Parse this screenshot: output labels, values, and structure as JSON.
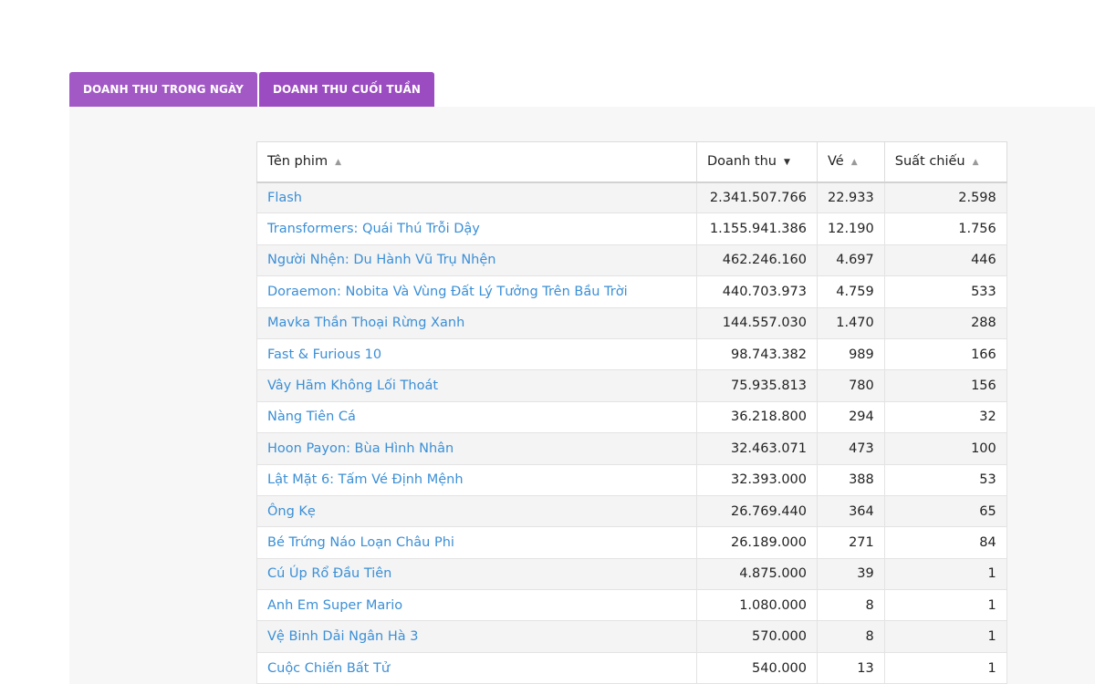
{
  "tabs": [
    {
      "label": "DOANH THU TRONG NGÀY",
      "active": false
    },
    {
      "label": "DOANH THU CUỐI TUẦN",
      "active": true
    }
  ],
  "table": {
    "columns": [
      {
        "label": "Tên phim",
        "sort": "up",
        "icon": "sort-up-icon"
      },
      {
        "label": "Doanh thu",
        "sort": "down",
        "icon": "sort-down-icon"
      },
      {
        "label": "Vé",
        "sort": "up",
        "icon": "sort-up-icon"
      },
      {
        "label": "Suất chiếu",
        "sort": "up",
        "icon": "sort-up-icon"
      }
    ],
    "rows": [
      {
        "title": "Flash",
        "revenue": "2.341.507.766",
        "tickets": "22.933",
        "showtimes": "2.598"
      },
      {
        "title": "Transformers: Quái Thú Trỗi Dậy",
        "revenue": "1.155.941.386",
        "tickets": "12.190",
        "showtimes": "1.756"
      },
      {
        "title": "Người Nhện: Du Hành Vũ Trụ Nhện",
        "revenue": "462.246.160",
        "tickets": "4.697",
        "showtimes": "446"
      },
      {
        "title": "Doraemon: Nobita Và Vùng Đất Lý Tưởng Trên Bầu Trời",
        "revenue": "440.703.973",
        "tickets": "4.759",
        "showtimes": "533"
      },
      {
        "title": "Mavka Thần Thoại Rừng Xanh",
        "revenue": "144.557.030",
        "tickets": "1.470",
        "showtimes": "288"
      },
      {
        "title": "Fast & Furious 10",
        "revenue": "98.743.382",
        "tickets": "989",
        "showtimes": "166"
      },
      {
        "title": "Vây Hãm Không Lối Thoát",
        "revenue": "75.935.813",
        "tickets": "780",
        "showtimes": "156"
      },
      {
        "title": "Nàng Tiên Cá",
        "revenue": "36.218.800",
        "tickets": "294",
        "showtimes": "32"
      },
      {
        "title": "Hoon Payon: Bùa Hình Nhân",
        "revenue": "32.463.071",
        "tickets": "473",
        "showtimes": "100"
      },
      {
        "title": "Lật Mặt 6: Tấm Vé Định Mệnh",
        "revenue": "32.393.000",
        "tickets": "388",
        "showtimes": "53"
      },
      {
        "title": "Ông Kẹ",
        "revenue": "26.769.440",
        "tickets": "364",
        "showtimes": "65"
      },
      {
        "title": "Bé Trứng Náo Loạn Châu Phi",
        "revenue": "26.189.000",
        "tickets": "271",
        "showtimes": "84"
      },
      {
        "title": "Cú Úp Rổ Đầu Tiên",
        "revenue": "4.875.000",
        "tickets": "39",
        "showtimes": "1"
      },
      {
        "title": "Anh Em Super Mario",
        "revenue": "1.080.000",
        "tickets": "8",
        "showtimes": "1"
      },
      {
        "title": "Vệ Binh Dải Ngân Hà 3",
        "revenue": "570.000",
        "tickets": "8",
        "showtimes": "1"
      },
      {
        "title": "Cuộc Chiến Bất Tử",
        "revenue": "540.000",
        "tickets": "13",
        "showtimes": "1"
      }
    ]
  },
  "colors": {
    "tab_bg": "#a259c6",
    "tab_text": "#ffffff",
    "link": "#3b8fd6",
    "panel_bg": "#f7f7f7"
  }
}
